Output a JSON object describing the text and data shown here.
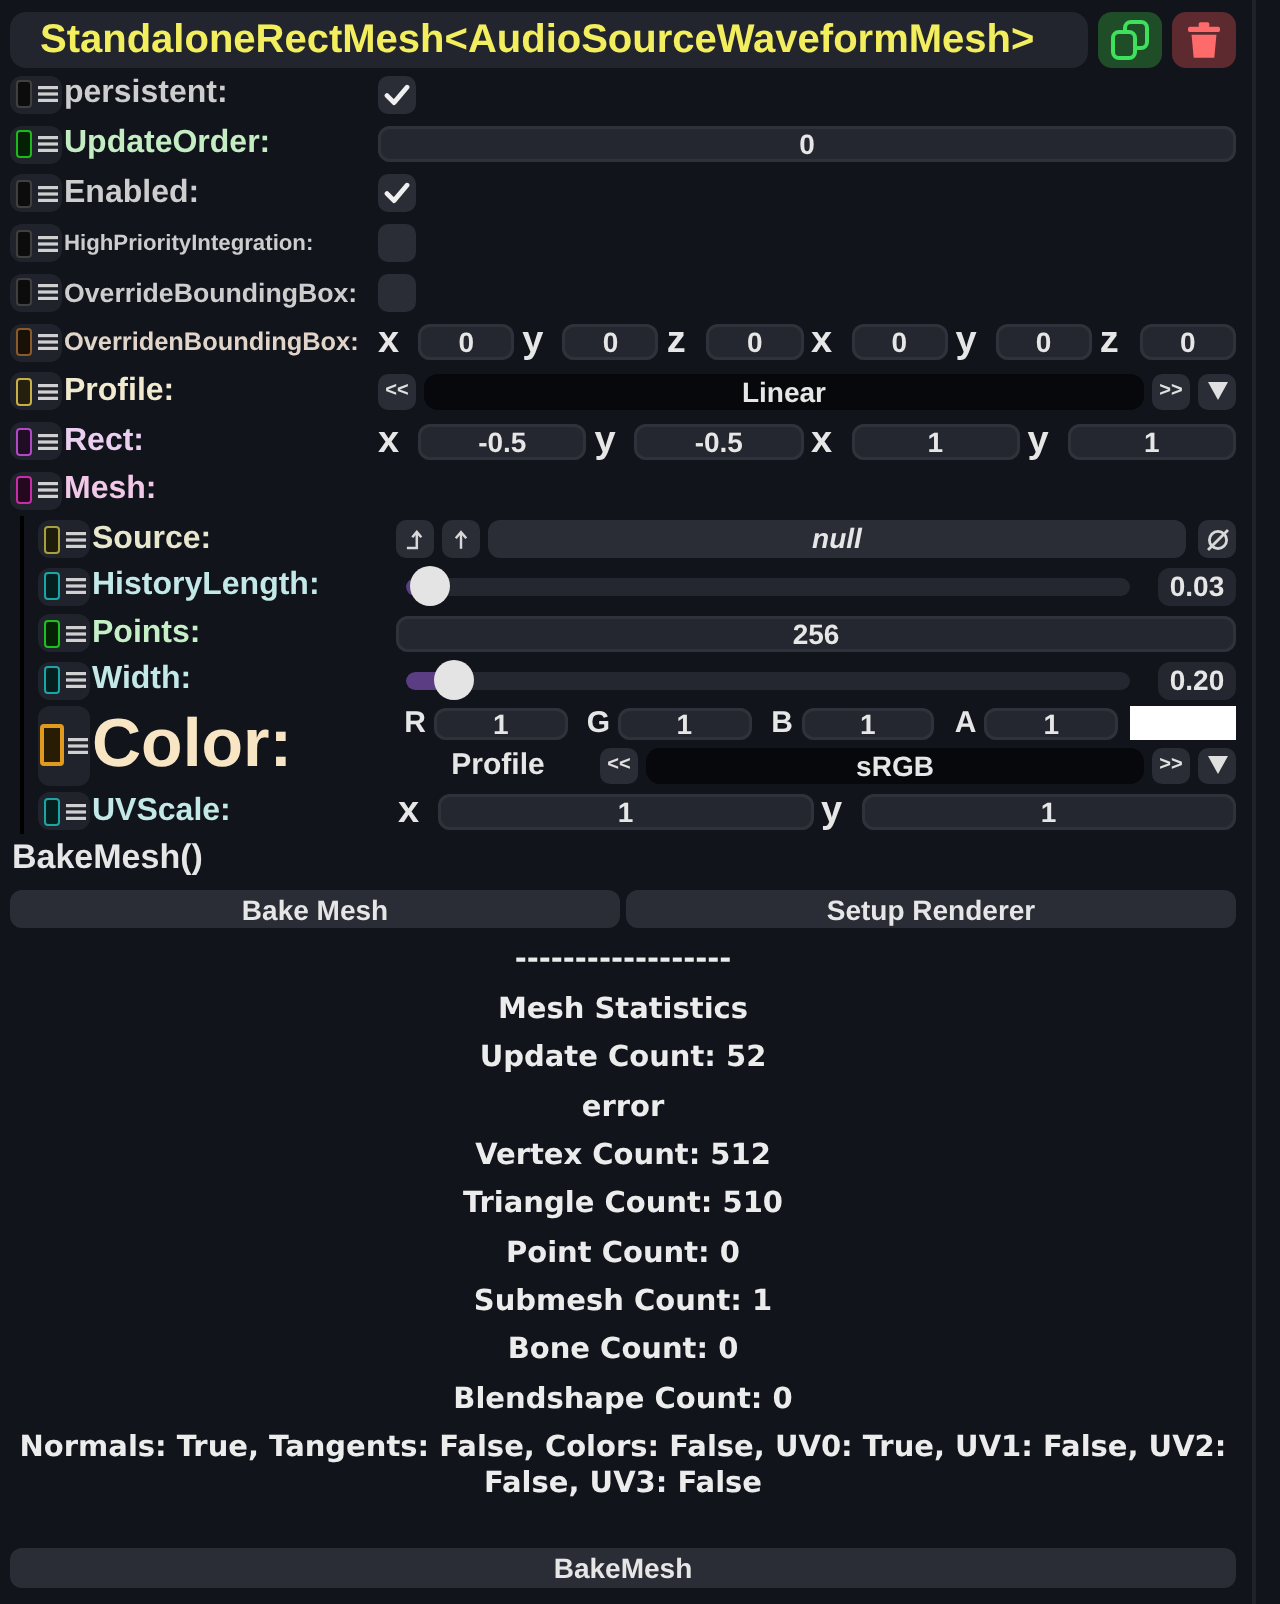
{
  "header": {
    "title": "StandaloneRectMesh<AudioSourceWaveformMesh>"
  },
  "fields": [
    {
      "kind": "checkbox",
      "label": "persistent:",
      "color": "#404040",
      "checked": true
    },
    {
      "kind": "number",
      "label": "UpdateOrder:",
      "color": "#1cb81c",
      "value": "0"
    },
    {
      "kind": "checkbox",
      "label": "Enabled:",
      "color": "#404040",
      "checked": true
    },
    {
      "kind": "checkbox",
      "label": "HighPriorityIntegration:",
      "color": "#404040",
      "checked": false
    },
    {
      "kind": "checkbox",
      "label": "OverrideBoundingBox:",
      "color": "#404040",
      "checked": false
    },
    {
      "kind": "vector",
      "label": "OverridenBoundingBox:",
      "color": "#8a5a2c",
      "components": [
        {
          "axis": "x",
          "value": "0"
        },
        {
          "axis": "y",
          "value": "0"
        },
        {
          "axis": "z",
          "value": "0"
        },
        {
          "axis": "x",
          "value": "0"
        },
        {
          "axis": "y",
          "value": "0"
        },
        {
          "axis": "z",
          "value": "0"
        }
      ]
    },
    {
      "kind": "enum",
      "label": "Profile:",
      "color": "#c8b048",
      "prev": "<<",
      "value": "Linear",
      "next": ">>"
    },
    {
      "kind": "vector",
      "label": "Rect:",
      "color": "#b048c8",
      "components": [
        {
          "axis": "x",
          "value": "-0.5"
        },
        {
          "axis": "y",
          "value": "-0.5"
        },
        {
          "axis": "x",
          "value": "1"
        },
        {
          "axis": "y",
          "value": "1"
        }
      ]
    },
    {
      "kind": "group",
      "label": "Mesh:",
      "color": "#c82ca8",
      "children": [
        {
          "kind": "reference",
          "label": "Source:",
          "color": "#a8a040",
          "value": "null"
        },
        {
          "kind": "slider",
          "label": "HistoryLength:",
          "color": "#1aa6a6",
          "level": 0.006,
          "reading": "0.03"
        },
        {
          "kind": "number",
          "label": "Points:",
          "color": "#1ec01e",
          "value": "256"
        },
        {
          "kind": "slider",
          "label": "Width:",
          "color": "#1aa6a6",
          "level": 0.04,
          "reading": "0.20"
        },
        {
          "kind": "color",
          "label": "Color:",
          "color": "#e09a1c",
          "channels": [
            {
              "name": "R",
              "value": "1"
            },
            {
              "name": "G",
              "value": "1"
            },
            {
              "name": "B",
              "value": "1"
            },
            {
              "name": "A",
              "value": "1"
            }
          ],
          "profile_label": "Profile",
          "profile": {
            "prev": "<<",
            "value": "sRGB",
            "next": ">>"
          }
        },
        {
          "kind": "vector",
          "label": "UVScale:",
          "color": "#1aa6a6",
          "components": [
            {
              "axis": "x",
              "value": "1"
            },
            {
              "axis": "y",
              "value": "1"
            }
          ]
        }
      ]
    }
  ],
  "method": {
    "label": "BakeMesh()",
    "buttons": [
      {
        "label": "Bake Mesh"
      },
      {
        "label": "Setup Renderer"
      }
    ]
  },
  "stats": {
    "divider": "------------------",
    "title": "Mesh Statistics",
    "lines": [
      "Update Count: 52",
      "error",
      "Vertex Count: 512",
      "Triangle Count: 510",
      "Point Count: 0",
      "Submesh Count: 1",
      "Bone Count: 0",
      "Blendshape Count: 0",
      "Normals: True, Tangents: False, Colors: False, UV0: True, UV1: False, UV2: False, UV3: False"
    ]
  },
  "footer_button": {
    "label": "BakeMesh"
  }
}
